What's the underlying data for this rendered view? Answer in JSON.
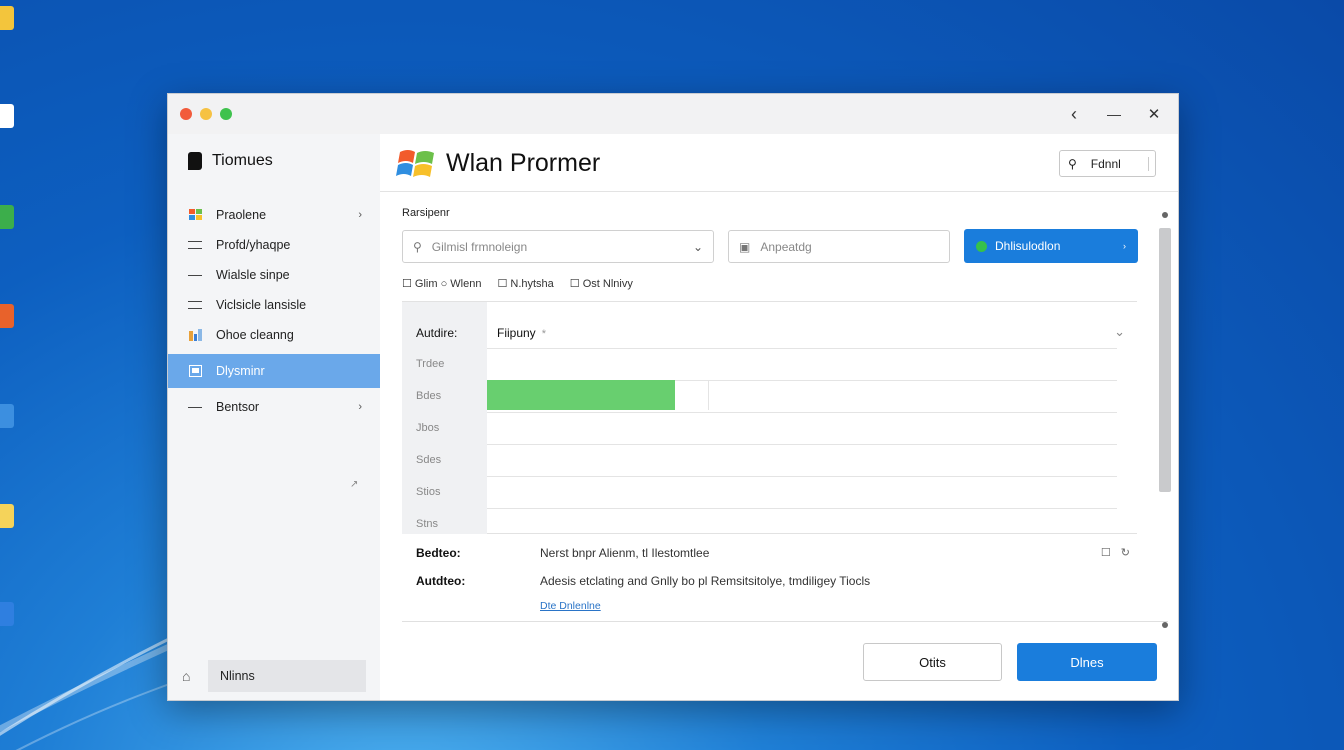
{
  "desktop": {
    "icons": [
      {
        "label": "",
        "color": "#f3c53c"
      },
      {
        "label": "",
        "color": "#ffffff"
      },
      {
        "label": "",
        "color": "#3cae4b"
      },
      {
        "label": "",
        "color": "#e8622b"
      },
      {
        "label": "",
        "color": "#3c8fe0"
      },
      {
        "label": "",
        "color": "#f5d35a"
      },
      {
        "label": "",
        "color": "#2f7fe0"
      }
    ]
  },
  "window": {
    "controls": {
      "back": "‹",
      "minimize": "—",
      "close": "✕"
    }
  },
  "sidebar": {
    "app_name": "Tiomues",
    "items": [
      {
        "label": "Praolene",
        "icon": "windows-flag-icon",
        "chevron": "›"
      },
      {
        "label": "Profd/yhaqpe",
        "icon": "lines-icon"
      },
      {
        "label": "Wialsle sinpe",
        "icon": "line-icon"
      },
      {
        "label": "Viclsicle lansisle",
        "icon": "lines-icon"
      },
      {
        "label": "Ohoe cleanng",
        "icon": "chart-icon"
      },
      {
        "label": "Dlysminr",
        "icon": "screen-icon",
        "active": true
      },
      {
        "label": "Bentsor",
        "icon": "line-icon",
        "chevron": "›"
      }
    ],
    "footer_label": "Nlinns"
  },
  "main": {
    "title": "Wlan Prormer",
    "header_button_label": "Fdnnl",
    "section_label": "Rarsipenr",
    "dropdown_placeholder": "Gilmisl frmnoleign",
    "search_placeholder": "Anpeatdg",
    "primary_action_label": "Dhlisulodlon",
    "filters": [
      "Glim ○ Wlenn",
      "N.hytsha",
      "Ost Nlnivy"
    ],
    "table": {
      "row_header": "Autdire:",
      "column_header": "Fiipuny",
      "column_star": "*",
      "rows": [
        "Trdee",
        "Bdes",
        "Jbos",
        "Sdes",
        "Stios",
        "Stns"
      ],
      "highlight_row_index": 1,
      "progress": 0.85
    },
    "details": [
      {
        "key": "Bedteo:",
        "value": "Nerst bnpr Alienm, tl Ilestomtlee"
      },
      {
        "key": "Autdteo:",
        "value": "Adesis etclating and Gnlly bo pl Remsitsitolye, tmdiligey Tiocls"
      }
    ],
    "details_link": "Dte Dnlenlne",
    "buttons": {
      "secondary": "Otits",
      "primary": "Dlnes"
    }
  },
  "colors": {
    "accent": "#1a7ddc",
    "sidebar_active": "#6aa8ea",
    "progress_green": "#68cf6f",
    "traffic_red": "#f25b3b",
    "traffic_yellow": "#f6c243",
    "traffic_green": "#3fc24d"
  }
}
